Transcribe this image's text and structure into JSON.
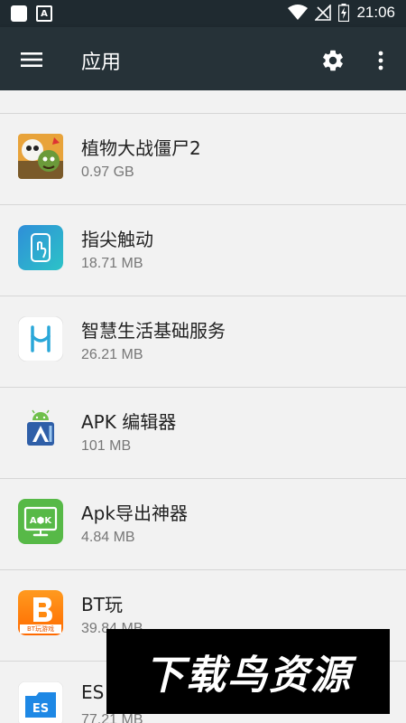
{
  "status_bar": {
    "time": "21:06",
    "notification_letter": "A"
  },
  "app_bar": {
    "title": "应用"
  },
  "apps": [
    {
      "name": "植物大战僵尸2",
      "size": "0.97 GB",
      "icon": "pvz2-icon"
    },
    {
      "name": "指尖触动",
      "size": "18.71 MB",
      "icon": "fingertip-touch-icon"
    },
    {
      "name": "智慧生活基础服务",
      "size": "26.21 MB",
      "icon": "smart-life-icon"
    },
    {
      "name": "APK 编辑器",
      "size": "101 MB",
      "icon": "apk-editor-icon"
    },
    {
      "name": "Apk导出神器",
      "size": "4.84 MB",
      "icon": "apk-export-icon"
    },
    {
      "name": "BT玩",
      "size": "39.84 MB",
      "icon": "bt-play-icon",
      "icon_caption": "BT玩游戏"
    },
    {
      "name": "ES",
      "size": "77.21 MB",
      "icon": "es-file-icon"
    }
  ],
  "watermark": {
    "text": "下载鸟资源"
  },
  "colors": {
    "status_bar": "#1f2a30",
    "app_bar": "#263238",
    "list_bg": "#f2f2f2"
  }
}
